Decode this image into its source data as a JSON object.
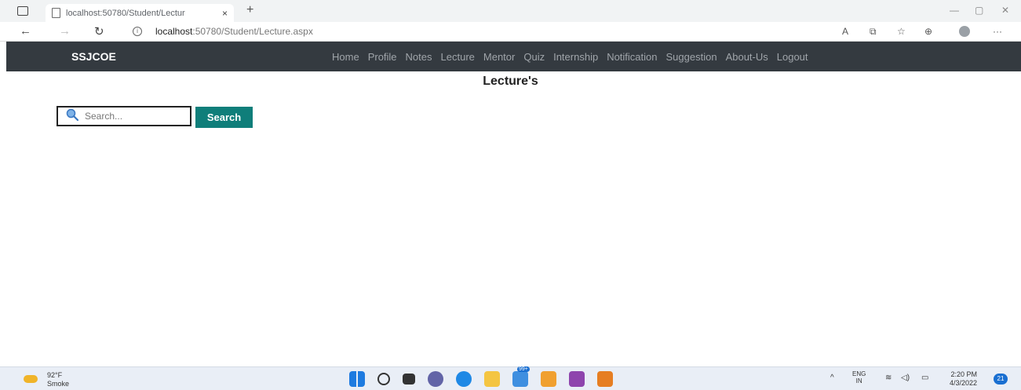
{
  "browser": {
    "tab_title": "localhost:50780/Student/Lectur",
    "tab_close": "×",
    "new_tab": "+",
    "url_host": "localhost",
    "url_rest": ":50780/Student/Lecture.aspx"
  },
  "navbar": {
    "brand": "SSJCOE",
    "links": [
      "Home",
      "Profile",
      "Notes",
      "Lecture",
      "Mentor",
      "Quiz",
      "Internship",
      "Notification",
      "Suggestion",
      "About-Us",
      "Logout"
    ]
  },
  "main": {
    "title": "Lecture's",
    "search": {
      "placeholder": "Search...",
      "button_label": "Search"
    }
  },
  "taskbar": {
    "weather_temp": "92°F",
    "weather_desc": "Smoke",
    "lang_top": "ENG",
    "lang_bottom": "IN",
    "time": "2:20 PM",
    "date": "4/3/2022",
    "notif_count": "21",
    "badge_count": "99+"
  },
  "colors": {
    "navbar_bg": "#343a40",
    "search_button": "#0f7e7a"
  }
}
